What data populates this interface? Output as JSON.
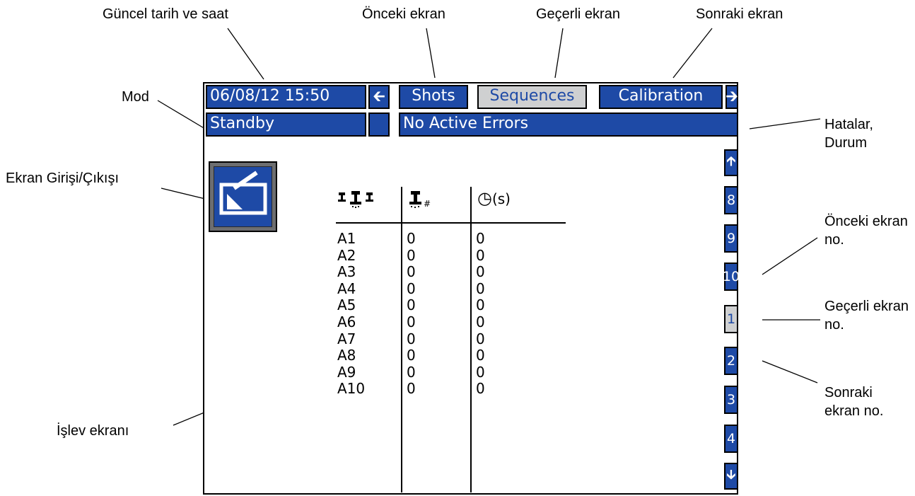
{
  "callouts": {
    "date_time": "Güncel tarih ve saat",
    "previous_screen": "Önceki ekran",
    "current_screen": "Geçerli ekran",
    "next_screen": "Sonraki ekran",
    "mode": "Mod",
    "errors_status": "Hatalar, Durum",
    "screen_enter_exit": "Ekran Girişi/Çıkışı",
    "function_screen": "İşlev ekranı",
    "previous_screen_no": "Önceki ekran no.",
    "current_screen_no": "Geçerli ekran no.",
    "next_screen_no": "Sonraki ekran no."
  },
  "header": {
    "datetime": "06/08/12 15:50",
    "left_arrow_icon": "arrow-left-icon",
    "tabs": [
      {
        "label": "Shots",
        "state": "inactive"
      },
      {
        "label": "Sequences",
        "state": "active"
      },
      {
        "label": "Calibration",
        "state": "inactive"
      }
    ],
    "right_arrow_icon": "arrow-right-icon",
    "mode": "Standby",
    "status": "No Active Errors"
  },
  "sidebar": {
    "up_icon": "arrow-up-icon",
    "pages": [
      "8",
      "9",
      "10",
      "1",
      "2",
      "3",
      "4"
    ],
    "current_page": "1",
    "down_icon": "arrow-down-icon"
  },
  "table": {
    "columns": [
      {
        "icon": "sequence-guns-icon"
      },
      {
        "icon": "shot-number-icon"
      },
      {
        "icon": "timer-icon",
        "unit": "(s)"
      }
    ],
    "rows": [
      {
        "id": "A1",
        "shot": "0",
        "time": "0"
      },
      {
        "id": "A2",
        "shot": "0",
        "time": "0"
      },
      {
        "id": "A3",
        "shot": "0",
        "time": "0"
      },
      {
        "id": "A4",
        "shot": "0",
        "time": "0"
      },
      {
        "id": "A5",
        "shot": "0",
        "time": "0"
      },
      {
        "id": "A6",
        "shot": "0",
        "time": "0"
      },
      {
        "id": "A7",
        "shot": "0",
        "time": "0"
      },
      {
        "id": "A8",
        "shot": "0",
        "time": "0"
      },
      {
        "id": "A9",
        "shot": "0",
        "time": "0"
      },
      {
        "id": "A10",
        "shot": "0",
        "time": "0"
      }
    ]
  },
  "colors": {
    "bar_blue": "#1e4aa6",
    "inactive_gray": "#cfd0d1"
  }
}
